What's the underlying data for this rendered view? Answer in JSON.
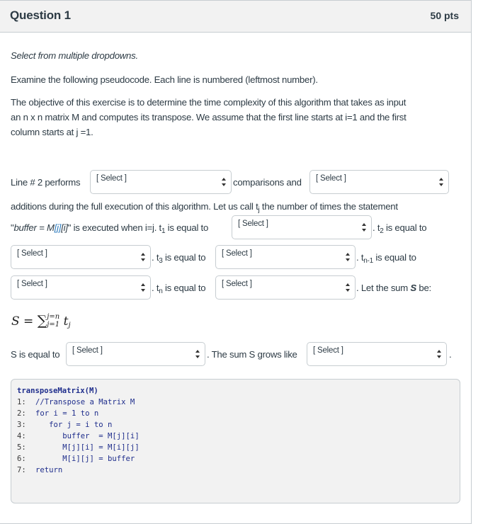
{
  "question": {
    "title": "Question 1",
    "points": "50 pts"
  },
  "instructions": {
    "type_label": "Select from multiple dropdowns.",
    "para1": "Examine the following pseudocode. Each line is numbered (leftmost number).",
    "para2_line1": "The objective of this exercise is to determine the time complexity of this algorithm that takes as input",
    "para2_line2": "an n x n matrix M  and computes its transpose. We assume that the first line starts at i=1 and the first",
    "para2_line3": "column starts at j =1."
  },
  "body": {
    "line2_performs": "Line # 2 performs",
    "comparisons_and": "comparisons and",
    "additions_text": "additions during the full execution of this algorithm. Let us call t",
    "additions_sub": "j",
    "additions_rest": " the number of times the statement",
    "stmt_open": "\"",
    "stmt_buffer": "buffer = M",
    "stmt_j": "[j]",
    "stmt_i": "[i]",
    "stmt_close": "\" is executed when i=j. t",
    "t1_sub": "1",
    "t1_rest": " is equal to",
    "t2_pre": ". t",
    "t2_sub": "2",
    "t2_rest": " is equal to",
    "t3_pre": ". t",
    "t3_sub": "3",
    "t3_rest": " is equal to",
    "tn1_pre": ". t",
    "tn1_sub": "n-1",
    "tn1_rest": " is equal to",
    "tn_pre": ". t",
    "tn_sub": "n",
    "tn_rest": " is equal to",
    "let_sum": ". Let the sum ",
    "let_sum_S": "S",
    "let_sum_be": " be:",
    "s_equal": "S is equal to",
    "grows_like": ". The sum S grows like",
    "final_period": "."
  },
  "formula": {
    "lhs": "S",
    "eq": " = ",
    "sigma": "∑",
    "upper": "j=n",
    "lower": "j=1",
    "term": "t",
    "term_sub": "j"
  },
  "dropdowns": [
    {
      "id": "line2-comparisons",
      "selected": "[ Select ]"
    },
    {
      "id": "line2-additions",
      "selected": "[ Select ]"
    },
    {
      "id": "t1",
      "selected": "[ Select ]"
    },
    {
      "id": "t2",
      "selected": "[ Select ]"
    },
    {
      "id": "t3",
      "selected": "[ Select ]"
    },
    {
      "id": "tn-1",
      "selected": "[ Select ]"
    },
    {
      "id": "tn",
      "selected": "[ Select ]"
    },
    {
      "id": "s-equal",
      "selected": "[ Select ]"
    },
    {
      "id": "s-grows",
      "selected": "[ Select ]"
    }
  ],
  "code": {
    "header": "transposeMatrix(M)",
    "lines": [
      {
        "num": "1:",
        "text": "//Transpose a Matrix M"
      },
      {
        "num": "2:",
        "text": "for i = 1 to n"
      },
      {
        "num": "3:",
        "text": "   for j = i to n"
      },
      {
        "num": "4:",
        "text": "      buffer  = M[j][i]"
      },
      {
        "num": "5:",
        "text": "      M[j][i] = M[i][j]"
      },
      {
        "num": "6:",
        "text": "      M[i][j] = buffer"
      },
      {
        "num": "7:",
        "text": "return"
      }
    ]
  }
}
